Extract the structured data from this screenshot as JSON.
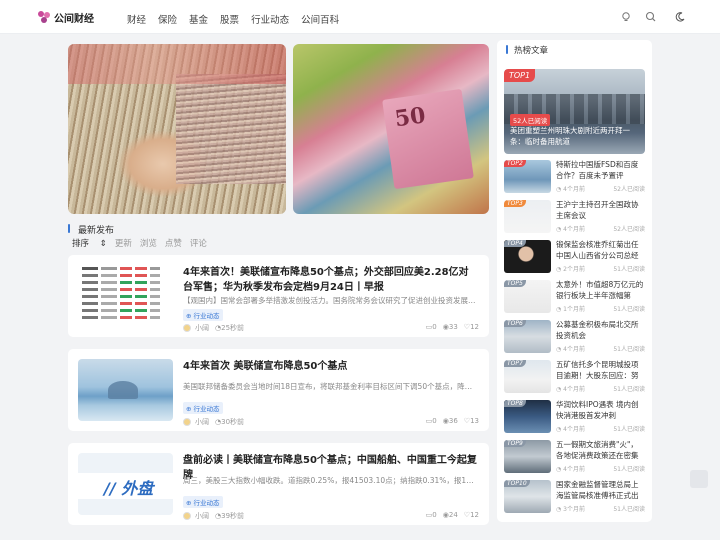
{
  "header": {
    "logo_text": "公间财经",
    "nav": [
      "财经",
      "保险",
      "基金",
      "股票",
      "行业动态",
      "公间百科"
    ]
  },
  "slider": {
    "slide2_numeral": "50"
  },
  "latest": {
    "title": "最新发布",
    "sort_label": "排序",
    "sort_options": [
      "更新",
      "浏览",
      "点赞",
      "评论"
    ]
  },
  "articles": [
    {
      "title": "4年来首次！美联储宣布降息50个基点；外交部回应美2.28亿对台军售；华为秋季发布会定档9月24日丨早报",
      "desc": "【观国内】国常会部署多举措激发创投活力。国务院常务会议研究了促进创业投资发展的有关…",
      "tag": "行业动态",
      "author": "小阔",
      "time": "25秒前",
      "comments": "0",
      "views": "33",
      "likes": "12"
    },
    {
      "title": "4年来首次 美联储宣布降息50个基点",
      "desc": "美国联邦储备委员会当地时间18日宣布，将联邦基金利率目标区间下调50个基点，降至4.75%…",
      "tag": "行业动态",
      "author": "小阔",
      "time": "30秒前",
      "comments": "0",
      "views": "36",
      "likes": "13"
    },
    {
      "title": "盘前必读丨美联储宣布降息50个基点；中国船舶、中国重工今起复牌",
      "desc": "周三，美股三大指数小幅收跌。道指跌0.25%，报41503.10点；纳指跌0.31%，报17573.30点…",
      "tag": "行业动态",
      "author": "小阔",
      "time": "39秒前",
      "comments": "0",
      "views": "24",
      "likes": "12",
      "thumb_text": "// 外盘"
    }
  ],
  "sidebar": {
    "title": "热榜文章",
    "top1": {
      "badge": "TOP1",
      "reads": "52人已阅读",
      "caption": "美团重塑兰州明珠大剧附近两开拜一条：临时备用航道"
    },
    "items": [
      {
        "badge": "TOP2",
        "title": "特斯拉中国版FSD和百度合作？百度未予置评",
        "time": "4个月前",
        "reads": "52人已阅读"
      },
      {
        "badge": "TOP3",
        "title": "王沪宁主持召开全国政协主席会议",
        "time": "4个月前",
        "reads": "52人已阅读"
      },
      {
        "badge": "TOP4",
        "title": "锻保监会核准乔红菊出任中国人山西省分公司总经理…",
        "time": "2个月前",
        "reads": "51人已阅读"
      },
      {
        "badge": "TOP5",
        "title": "太意外！市值超8万亿元的银行板块上半年涨幅第一！…",
        "time": "1个月前",
        "reads": "51人已阅读"
      },
      {
        "badge": "TOP6",
        "title": "公募基金积极布局北交所投资机会",
        "time": "4个月前",
        "reads": "51人已阅读"
      },
      {
        "badge": "TOP7",
        "title": "五矿信托多个昆明城投项目逾期！大股东回应：努力…",
        "time": "4个月前",
        "reads": "51人已阅读"
      },
      {
        "badge": "TOP8",
        "title": "华润饮料IPO遇表 境内创快消港股首发冲刺",
        "time": "4个月前",
        "reads": "51人已阅读"
      },
      {
        "badge": "TOP9",
        "title": "五一假期文旅消费\"火\"，各地促消费政策还在密集出台",
        "time": "4个月前",
        "reads": "51人已阅读"
      },
      {
        "badge": "TOP10",
        "title": "国家金融监督管理总局上海监管局核准傅祎正式出任…",
        "time": "3个月前",
        "reads": "51人已阅读"
      }
    ]
  },
  "colors": {
    "accent": "#3a78d4",
    "top_badge": "#e64b4b",
    "badge_colors": [
      "#e64b4b",
      "#f08a3c",
      "#f0a73c",
      "#8a97a6"
    ]
  },
  "icons": [
    "bulb-icon",
    "search-icon",
    "moon-icon",
    "back-to-top-icon"
  ]
}
